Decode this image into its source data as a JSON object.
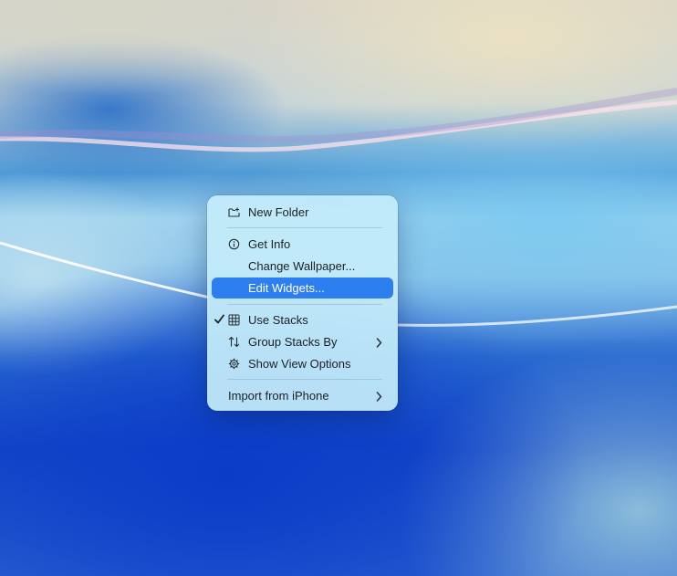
{
  "menu": {
    "new_folder": "New Folder",
    "get_info": "Get Info",
    "change_wallpaper": "Change Wallpaper...",
    "edit_widgets": "Edit Widgets...",
    "use_stacks": "Use Stacks",
    "group_stacks_by": "Group Stacks By",
    "show_view_options": "Show View Options",
    "import_from_iphone": "Import from iPhone"
  },
  "icons": {
    "new_folder": "folder-plus-icon",
    "get_info": "info-circle-icon",
    "use_stacks": "grid-icon",
    "group_stacks_by": "sort-arrows-icon",
    "show_view_options": "gear-icon",
    "checkmark": "checkmark-icon",
    "submenu": "chevron-right-icon"
  },
  "state": {
    "highlighted_item": "Edit Widgets...",
    "use_stacks_checked": true
  },
  "colors": {
    "highlight": "#2d7ff0",
    "menu_background": "#c4ecfa",
    "text": "#1c1f24"
  }
}
